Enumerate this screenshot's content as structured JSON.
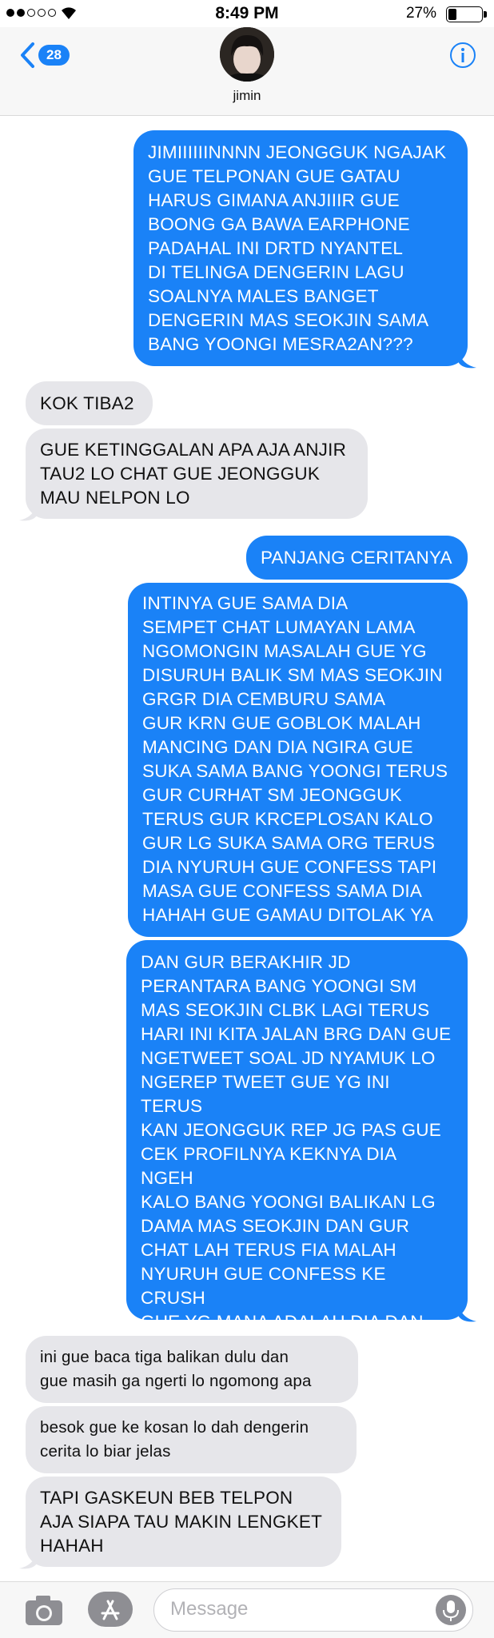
{
  "status_bar": {
    "time": "8:49 PM",
    "battery": "27%"
  },
  "header": {
    "back_count": "28",
    "contact_name": "jimin"
  },
  "messages": [
    {
      "side": "sent",
      "text": "JIMIIIIIINNNN JEONGGUK NGAJAK\nGUE TELPONAN GUE GATAU\nHARUS GIMANA ANJIIIR GUE\nBOONG GA BAWA EARPHONE\nPADAHAL INI DRTD NYANTEL\nDI TELINGA DENGERIN LAGU\nSOALNYA MALES BANGET\nDENGERIN MAS SEOKJIN SAMA\nBANG YOONGI MESRA2AN???"
    },
    {
      "side": "recv",
      "text": "KOK TIBA2"
    },
    {
      "side": "recv",
      "text": "GUE KETINGGALAN APA AJA ANJIR\nTAU2 LO CHAT GUE JEONGGUK\nMAU NELPON LO"
    },
    {
      "side": "sent",
      "text": "PANJANG CERITANYA"
    },
    {
      "side": "sent",
      "text": "INTINYA GUE SAMA DIA\nSEMPET CHAT LUMAYAN LAMA\nNGOMONGIN MASALAH GUE YG\nDISURUH BALIK SM MAS SEOKJIN\nGRGR DIA CEMBURU SAMA\nGUR KRN GUE GOBLOK MALAH\nMANCING DAN DIA NGIRA GUE\nSUKA SAMA BANG YOONGI TERUS\nGUR CURHAT SM JEONGGUK\nTERUS GUR KRCEPLOSAN KALO\nGUR LG SUKA SAMA ORG TERUS\nDIA NYURUH GUE CONFESS TAPI\nMASA GUE CONFESS SAMA DIA\nHAHAH GUE GAMAU DITOLAK YA"
    },
    {
      "side": "sent",
      "text": "DAN GUR BERAKHIR JD\nPERANTARA BANG YOONGI SM\nMAS SEOKJIN CLBK LAGI TERUS\nHARI INI KITA JALAN BRG DAN GUE\nNGETWEET SOAL JD NYAMUK LO\nNGEREP TWEET GUE YG INI TERUS\nKAN JEONGGUK REP JG PAS GUE\nCEK PROFILNYA KEKNYA DIA NGEH\nKALO BANG YOONGI BALIKAN LG\nDAMA MAS SEOKJIN DAN GUR\nCHAT LAH TERUS FIA MALAH\nNYURUH GUE CONFESS KE CRUSH\nGUE YG MANA ADALAH DIA DAN\nGUE TOLAK AJA TERUS YAAAA\nSKRG MALAH NGAJAK TELPON"
    },
    {
      "side": "recv",
      "text": "ini gue baca tiga balikan dulu dan\ngue masih ga ngerti lo ngomong apa"
    },
    {
      "side": "recv",
      "text": "besok gue ke kosan lo dah dengerin\ncerita lo biar jelas"
    },
    {
      "side": "recv",
      "text": "TAPI GASKEUN BEB TELPON\nAJA SIAPA TAU MAKIN LENGKET\nHAHAH"
    }
  ],
  "input": {
    "placeholder": "Message",
    "value": ""
  },
  "colors": {
    "sent_bubble": "#1a82f7",
    "received_bubble": "#e6e6ea",
    "accent": "#1a82f7"
  },
  "icons": [
    "wifi-icon",
    "back-chevron-icon",
    "info-icon",
    "camera-icon",
    "app-store-icon",
    "microphone-icon"
  ]
}
